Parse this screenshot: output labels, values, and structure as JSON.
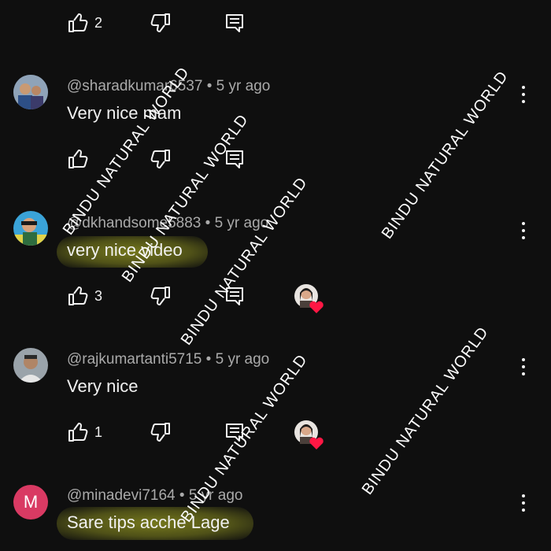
{
  "watermark": "BINDU NATURAL WORLD",
  "colors": {
    "highlight": "#c8cd28",
    "heart": "#ff1744",
    "avatar_m": "#d93a63"
  },
  "top_row": {
    "likes": "2"
  },
  "comments": [
    {
      "handle": "@sharadkumar6537",
      "age": "5 yr ago",
      "text": "Very nice mam",
      "likes": ""
    },
    {
      "handle": "@dkhandsome5883",
      "age": "5 yr ago",
      "text": "very nice video",
      "likes": "3",
      "creator_heart": true
    },
    {
      "handle": "@rajkumartanti5715",
      "age": "5 yr ago",
      "text": "Very nice",
      "likes": "1",
      "creator_heart": true
    },
    {
      "handle": "@minadevi7164",
      "age": "5 yr ago",
      "text": "Sare tips acche Lage",
      "likes": "",
      "avatar_letter": "M"
    }
  ],
  "separator": "•",
  "icons": [
    "thumbs-up-icon",
    "thumbs-down-icon",
    "reply-icon",
    "more-vert-icon",
    "heart-icon"
  ]
}
